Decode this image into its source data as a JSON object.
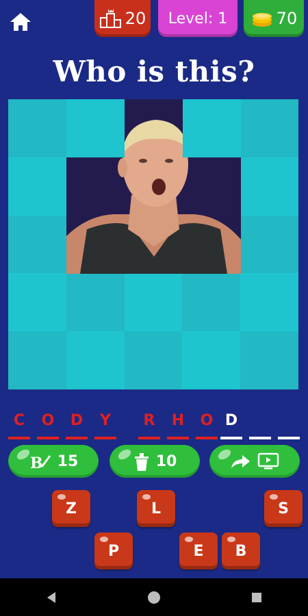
{
  "header": {
    "rank_value": "20",
    "level_label": "Level: 1",
    "coins_value": "70"
  },
  "question": "Who is this?",
  "answer_slots": [
    {
      "letter": "C",
      "state": "revealed"
    },
    {
      "letter": "O",
      "state": "revealed"
    },
    {
      "letter": "D",
      "state": "revealed"
    },
    {
      "letter": "Y",
      "state": "revealed"
    },
    {
      "letter": "",
      "state": "space"
    },
    {
      "letter": "R",
      "state": "revealed"
    },
    {
      "letter": "H",
      "state": "revealed"
    },
    {
      "letter": "O",
      "state": "revealed"
    },
    {
      "letter": "D",
      "state": "current"
    },
    {
      "letter": "",
      "state": "empty"
    },
    {
      "letter": "",
      "state": "empty"
    }
  ],
  "hints": [
    {
      "name": "hint-reveal-letter-button",
      "icon": "reveal-letter-icon",
      "cost": "15"
    },
    {
      "name": "hint-remove-letters-button",
      "icon": "trash-icon",
      "cost": "10"
    },
    {
      "name": "hint-share-video-button",
      "icon": "share-video-icon",
      "cost": ""
    }
  ],
  "keyboard": [
    {
      "letter": "Z"
    },
    {
      "letter": "L"
    },
    {
      "letter": "S"
    },
    {
      "letter": "P"
    },
    {
      "letter": "E"
    },
    {
      "letter": "B"
    }
  ],
  "colors": {
    "background": "#1b2a86",
    "tile_light": "#1ec5cf",
    "tile_dark": "#22b8c4",
    "accent_red": "#e02020",
    "button_green": "#2fbf3c",
    "key_red": "#c93818"
  }
}
